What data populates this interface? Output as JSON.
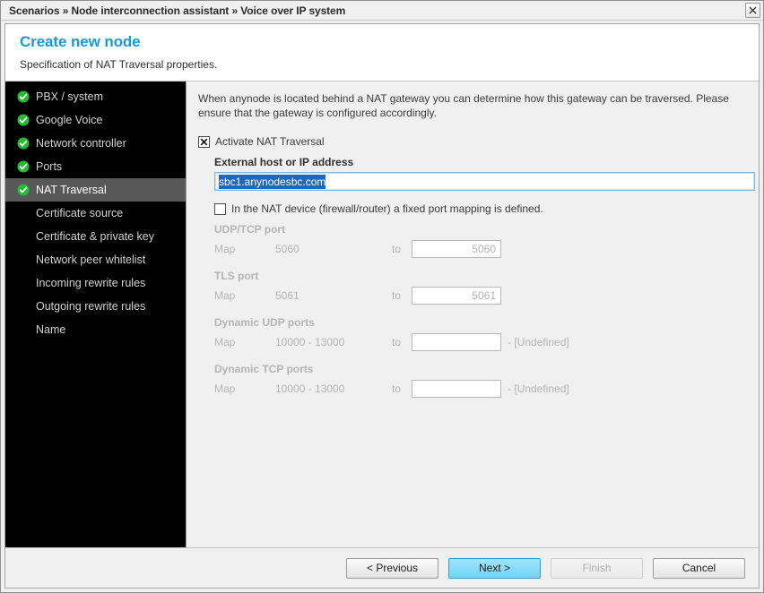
{
  "titlebar": {
    "breadcrumb": "Scenarios » Node interconnection assistant » Voice over IP system",
    "close_icon": "close-icon"
  },
  "header": {
    "title": "Create new node",
    "subtitle": "Specification of NAT Traversal properties.",
    "title_color": "#0f9ed5"
  },
  "sidebar": {
    "items": [
      {
        "label": "PBX / system",
        "state": "done",
        "selected": false
      },
      {
        "label": "Google Voice",
        "state": "done",
        "selected": false
      },
      {
        "label": "Network controller",
        "state": "done",
        "selected": false
      },
      {
        "label": "Ports",
        "state": "done",
        "selected": false
      },
      {
        "label": "NAT Traversal",
        "state": "done",
        "selected": true
      },
      {
        "label": "Certificate source",
        "state": "pending",
        "selected": false
      },
      {
        "label": "Certificate & private key",
        "state": "pending",
        "selected": false
      },
      {
        "label": "Network peer whitelist",
        "state": "pending",
        "selected": false
      },
      {
        "label": "Incoming rewrite rules",
        "state": "pending",
        "selected": false
      },
      {
        "label": "Outgoing rewrite rules",
        "state": "pending",
        "selected": false
      },
      {
        "label": "Name",
        "state": "pending",
        "selected": false
      }
    ],
    "done_icon": "check-circle-icon",
    "done_color": "#22bb33"
  },
  "content": {
    "intro": "When anynode is located behind a NAT gateway you can determine how this gateway can be traversed. Please ensure that the gateway is configured accordingly.",
    "activate_checkbox": {
      "label": "Activate NAT Traversal",
      "checked": true,
      "mark_icon": "x-mark-icon"
    },
    "external_host": {
      "label": "External host or IP address",
      "value": "sbc1.anynodesbc.com",
      "selected": true,
      "selection_color": "#1569c7"
    },
    "fixed_mapping_checkbox": {
      "label": "In the NAT device (firewall/router) a fixed port mapping is defined.",
      "checked": false
    },
    "map_word": "Map",
    "to_word": "to",
    "port_groups": [
      {
        "title": "UDP/TCP port",
        "from": "5060",
        "to_value": "5060",
        "suffix": ""
      },
      {
        "title": "TLS port",
        "from": "5061",
        "to_value": "5061",
        "suffix": ""
      },
      {
        "title": "Dynamic UDP ports",
        "from": "10000 - 13000",
        "to_value": "",
        "suffix": "- [Undefined]"
      },
      {
        "title": "Dynamic TCP ports",
        "from": "10000 - 13000",
        "to_value": "",
        "suffix": "- [Undefined]"
      }
    ]
  },
  "footer": {
    "previous_label": "< Previous",
    "next_label": "Next >",
    "finish_label": "Finish",
    "cancel_label": "Cancel",
    "next_color": "#72d4f7"
  }
}
